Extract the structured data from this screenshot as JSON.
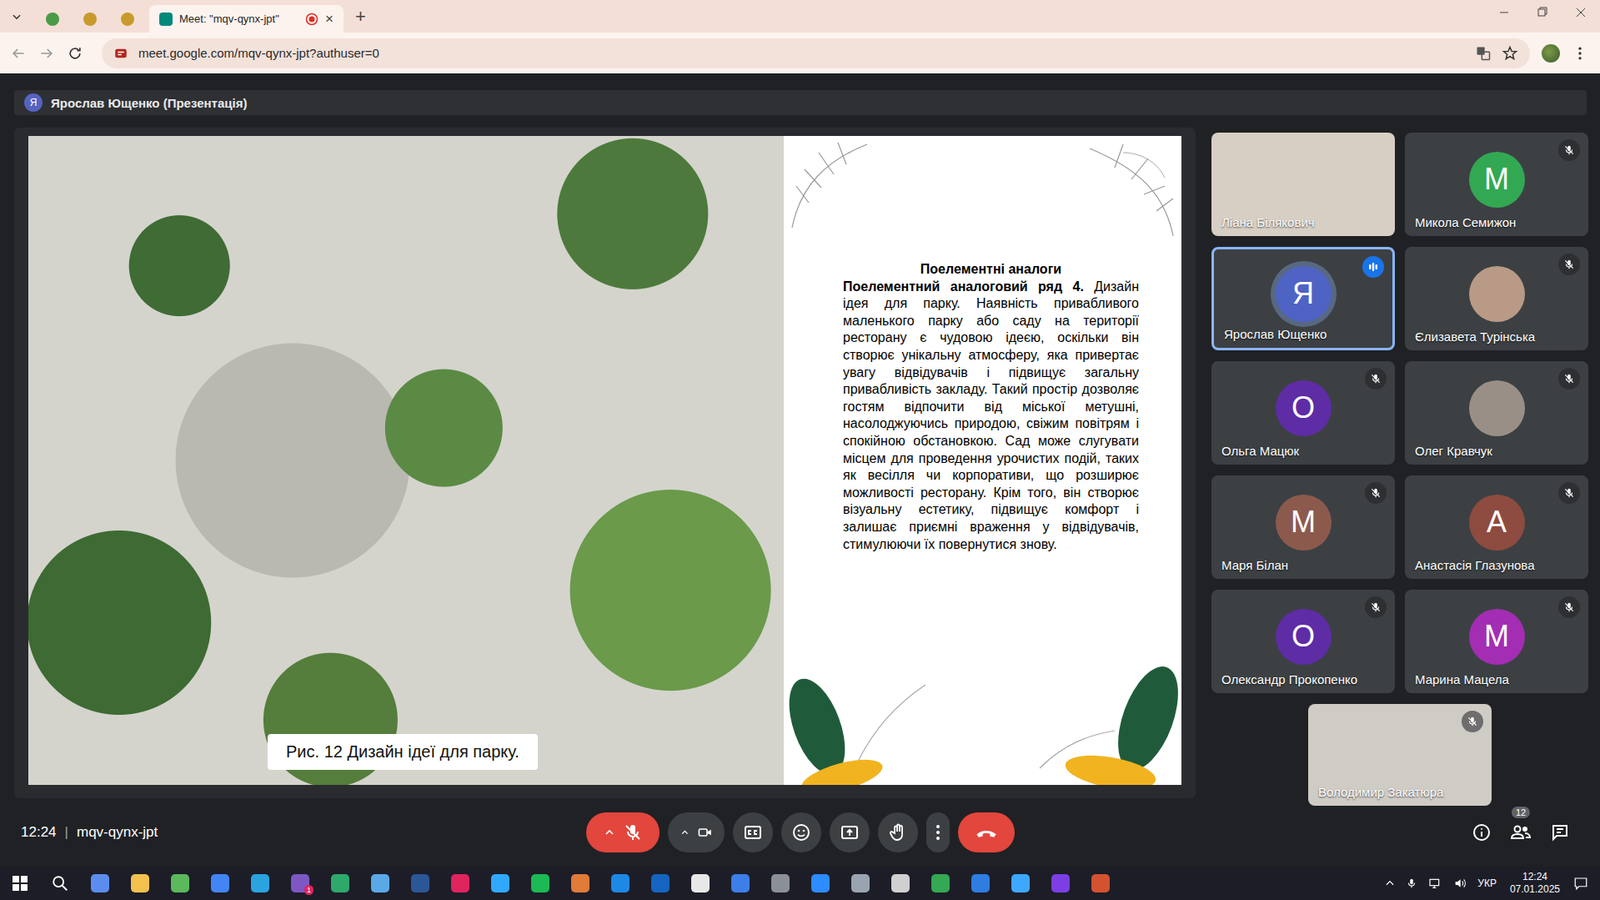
{
  "browser": {
    "tabs": [
      {
        "label": "",
        "favicon": "#4a9b46",
        "selected": false,
        "recording": false
      },
      {
        "label": "",
        "favicon": "#c79a2b",
        "selected": false,
        "recording": false
      },
      {
        "label": "",
        "favicon": "#c79a2b",
        "selected": false,
        "recording": false
      },
      {
        "label": "Meet: \"mqv-qynx-jpt\"",
        "favicon": "#00897b",
        "selected": true,
        "recording": true
      }
    ],
    "close_tab": "×",
    "new_tab": "+",
    "url": "meet.google.com/mqv-qynx-jpt?authuser=0"
  },
  "meeting": {
    "presenter": {
      "initial": "Я",
      "label": "Ярослав Ющенко (Презентація)"
    },
    "slide": {
      "heading": "Поелементні аналоги",
      "lead": "Поелементний аналоговий ряд 4.",
      "body": "Дизайн ідея для парку. Наявність привабливого маленького парку або саду на території ресторану є чудовою ідеєю, оскільки він створює унікальну атмосферу, яка привертає увагу відвідувачів і підвищує загальну привабливість закладу. Такий простір дозволяє гостям відпочити від міської метушні, насолоджуючись природою, свіжим повітрям і спокійною обстановкою. Сад може слугувати місцем для проведення урочистих подій, таких як весілля чи корпоративи, що розширює можливості ресторану. Крім того, він створює візуальну естетику, підвищує комфорт і залишає приємні враження у відвідувачів, стимулюючи їх повернутися знову.",
      "caption": "Рис. 12 Дизайн ідеї для парку."
    },
    "participants": [
      {
        "name": "Ліана Білякович",
        "kind": "video",
        "color": "#d8cfc4",
        "muted": false,
        "speaking": false
      },
      {
        "name": "Микола Семижон",
        "kind": "avatar",
        "initial": "М",
        "color": "#33a853",
        "muted": true,
        "speaking": false
      },
      {
        "name": "Ярослав Ющенко",
        "kind": "avatar",
        "initial": "Я",
        "color": "#4f63c4",
        "muted": false,
        "speaking": true
      },
      {
        "name": "Єлизавета Турінська",
        "kind": "photo",
        "color": "#b89a86",
        "muted": true,
        "speaking": false
      },
      {
        "name": "Ольга Мацюк",
        "kind": "avatar",
        "initial": "О",
        "color": "#5e2ca5",
        "muted": true,
        "speaking": false
      },
      {
        "name": "Олег Кравчук",
        "kind": "photo",
        "color": "#9a8f86",
        "muted": true,
        "speaking": false
      },
      {
        "name": "Маря Білан",
        "kind": "avatar",
        "initial": "М",
        "color": "#8c5a4d",
        "muted": true,
        "speaking": false
      },
      {
        "name": "Анастасія Глазунова",
        "kind": "avatar",
        "initial": "А",
        "color": "#8e4b3f",
        "muted": true,
        "speaking": false
      },
      {
        "name": "Олександр Прокопенко",
        "kind": "avatar",
        "initial": "О",
        "color": "#5e2ca5",
        "muted": true,
        "speaking": false
      },
      {
        "name": "Марина Мацела",
        "kind": "avatar",
        "initial": "М",
        "color": "#a32db3",
        "muted": true,
        "speaking": false
      },
      {
        "name": "Володимир Закатюра",
        "kind": "video",
        "color": "#cfcbc5",
        "muted": true,
        "speaking": false
      }
    ],
    "controls": {
      "time": "12:24",
      "separator": "|",
      "code": "mqv-qynx-jpt",
      "mic_muted": true,
      "camera_on": true,
      "people_count": "12"
    }
  },
  "taskbar": {
    "apps": [
      {
        "color": "#5b8def",
        "badge": ""
      },
      {
        "color": "#f2c14e",
        "badge": ""
      },
      {
        "color": "#5cb85c",
        "badge": ""
      },
      {
        "color": "#4285f4",
        "badge": ""
      },
      {
        "color": "#2aa3e0",
        "badge": ""
      },
      {
        "color": "#7d58c4",
        "badge": "1"
      },
      {
        "color": "#2ea86b",
        "badge": ""
      },
      {
        "color": "#5aa9e6",
        "badge": ""
      },
      {
        "color": "#2b5797",
        "badge": ""
      },
      {
        "color": "#e0245e",
        "badge": ""
      },
      {
        "color": "#31a8ff",
        "badge": ""
      },
      {
        "color": "#1db954",
        "badge": ""
      },
      {
        "color": "#e07b39",
        "badge": ""
      },
      {
        "color": "#1e88e5",
        "badge": ""
      },
      {
        "color": "#1565c0",
        "badge": ""
      },
      {
        "color": "#e8e8e8",
        "badge": ""
      },
      {
        "color": "#3d7ee8",
        "badge": ""
      },
      {
        "color": "#8a8f98",
        "badge": ""
      },
      {
        "color": "#2d8cff",
        "badge": ""
      },
      {
        "color": "#9aa4b1",
        "badge": ""
      },
      {
        "color": "#d0d0d0",
        "badge": ""
      },
      {
        "color": "#34a853",
        "badge": ""
      },
      {
        "color": "#2f7de1",
        "badge": ""
      },
      {
        "color": "#3ea8ff",
        "badge": ""
      },
      {
        "color": "#7b3fe4",
        "badge": ""
      },
      {
        "color": "#d35230",
        "badge": ""
      }
    ],
    "language": "УКР",
    "time": "12:24",
    "date": "07.01.2025"
  }
}
